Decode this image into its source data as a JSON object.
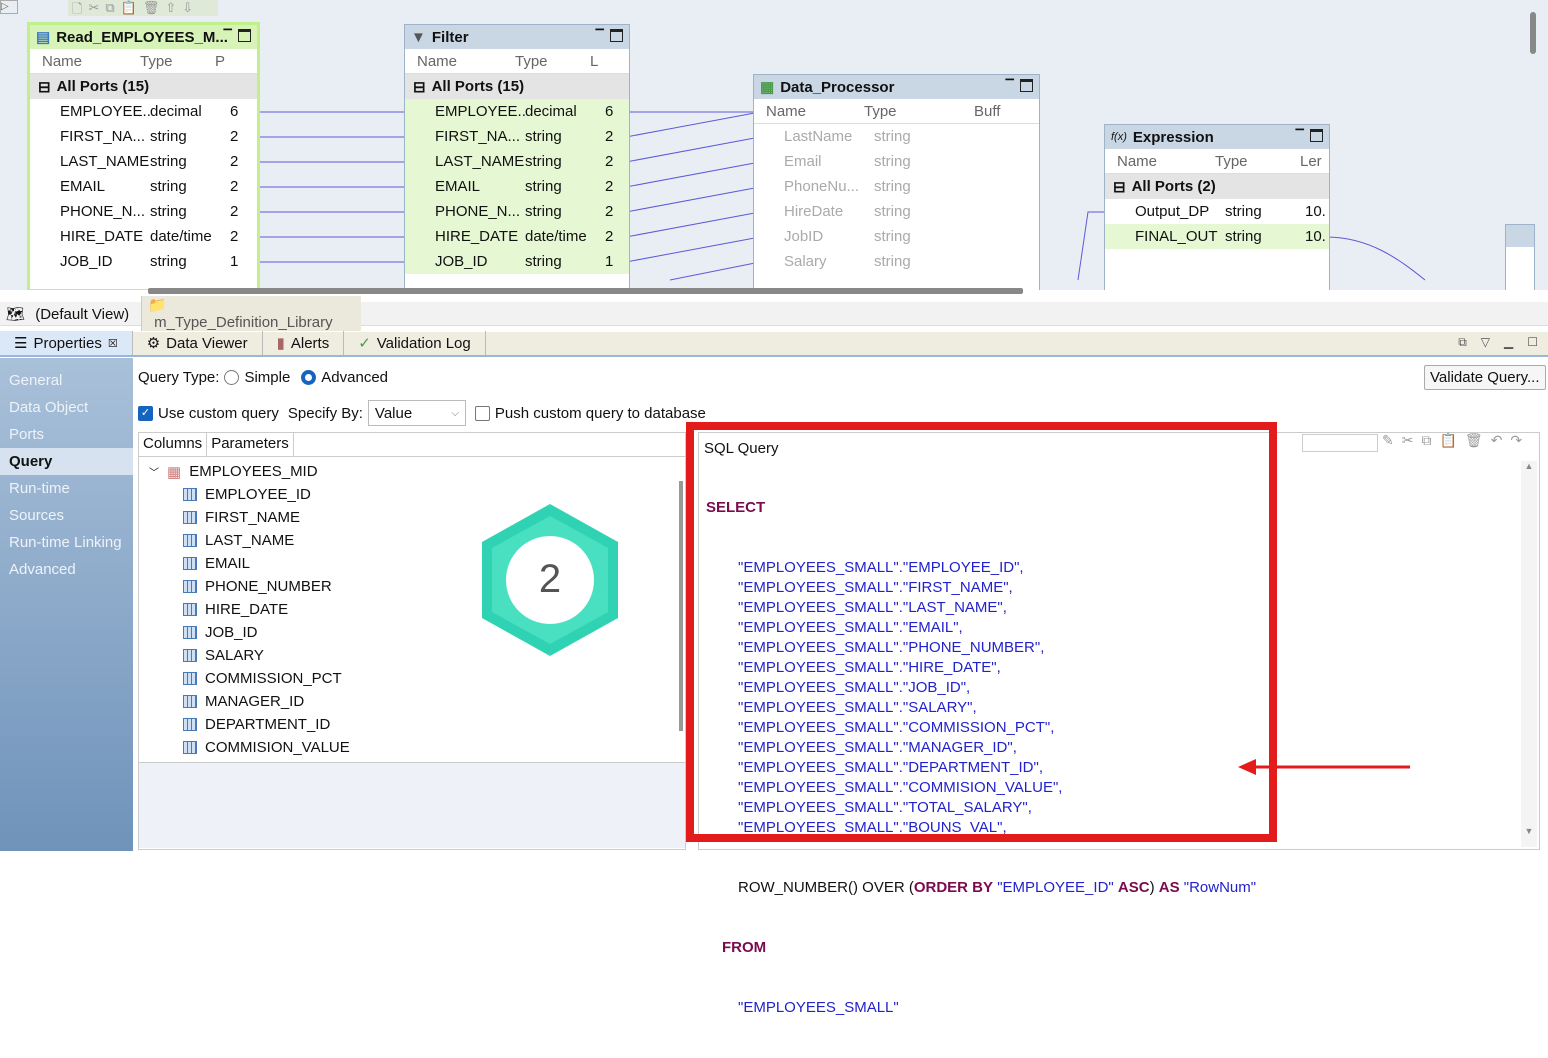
{
  "canvas": {
    "toolbar_icons": [
      "new-icon",
      "cut-icon",
      "copy-icon",
      "paste-icon",
      "delete-icon",
      "move-up-icon",
      "move-down-icon"
    ],
    "read_obj": {
      "title": "Read_EMPLOYEES_M...",
      "col_name": "Name",
      "col_type": "Type",
      "col_extra": "P",
      "group": "All Ports (15)",
      "ports": [
        {
          "n": "EMPLOYEE...",
          "t": "decimal",
          "x": "6"
        },
        {
          "n": "FIRST_NA...",
          "t": "string",
          "x": "2"
        },
        {
          "n": "LAST_NAME",
          "t": "string",
          "x": "2"
        },
        {
          "n": "EMAIL",
          "t": "string",
          "x": "2"
        },
        {
          "n": "PHONE_N...",
          "t": "string",
          "x": "2"
        },
        {
          "n": "HIRE_DATE",
          "t": "date/time",
          "x": "2"
        },
        {
          "n": "JOB_ID",
          "t": "string",
          "x": "1"
        }
      ]
    },
    "filter_obj": {
      "title": "Filter",
      "col_name": "Name",
      "col_type": "Type",
      "col_extra": "L",
      "group": "All Ports (15)",
      "ports": [
        {
          "n": "EMPLOYEE...",
          "t": "decimal",
          "x": "6"
        },
        {
          "n": "FIRST_NA...",
          "t": "string",
          "x": "2"
        },
        {
          "n": "LAST_NAME",
          "t": "string",
          "x": "2"
        },
        {
          "n": "EMAIL",
          "t": "string",
          "x": "2"
        },
        {
          "n": "PHONE_N...",
          "t": "string",
          "x": "2"
        },
        {
          "n": "HIRE_DATE",
          "t": "date/time",
          "x": "2"
        },
        {
          "n": "JOB_ID",
          "t": "string",
          "x": "1"
        }
      ]
    },
    "dp_obj": {
      "title": "Data_Processor",
      "col_name": "Name",
      "col_type": "Type",
      "col_extra": "Buff",
      "ports": [
        {
          "n": "LastName",
          "t": "string"
        },
        {
          "n": "Email",
          "t": "string"
        },
        {
          "n": "PhoneNu...",
          "t": "string"
        },
        {
          "n": "HireDate",
          "t": "string"
        },
        {
          "n": "JobID",
          "t": "string"
        },
        {
          "n": "Salary",
          "t": "string"
        }
      ]
    },
    "expr_obj": {
      "title": "Expression",
      "col_name": "Name",
      "col_type": "Type",
      "col_extra": "Ler",
      "group": "All Ports (2)",
      "ports": [
        {
          "n": "Output_DP",
          "t": "string",
          "x": "10."
        },
        {
          "n": "FINAL_OUT",
          "t": "string",
          "x": "10."
        }
      ]
    }
  },
  "editor_tabs": [
    "(Default View)",
    "m_Type_Definition_Library"
  ],
  "panel_tabs": [
    "Properties",
    "Data Viewer",
    "Alerts",
    "Validation Log"
  ],
  "sidebar": [
    "General",
    "Data Object",
    "Ports",
    "Query",
    "Run-time",
    "Sources",
    "Run-time Linking",
    "Advanced"
  ],
  "query": {
    "type_label": "Query Type:",
    "simple": "Simple",
    "advanced": "Advanced",
    "use_custom": "Use custom query",
    "specify_by": "Specify By:",
    "specify_value": "Value",
    "push": "Push custom query to database",
    "validate": "Validate Query...",
    "tab_columns": "Columns",
    "tab_parameters": "Parameters",
    "tree_root": "EMPLOYEES_MID",
    "tree_items": [
      "EMPLOYEE_ID",
      "FIRST_NAME",
      "LAST_NAME",
      "EMAIL",
      "PHONE_NUMBER",
      "HIRE_DATE",
      "JOB_ID",
      "SALARY",
      "COMMISSION_PCT",
      "MANAGER_ID",
      "DEPARTMENT_ID",
      "COMMISION_VALUE"
    ],
    "sql_label": "SQL Query",
    "select": "SELECT",
    "select_cols": [
      "\"EMPLOYEES_SMALL\".\"EMPLOYEE_ID\",",
      "\"EMPLOYEES_SMALL\".\"FIRST_NAME\",",
      "\"EMPLOYEES_SMALL\".\"LAST_NAME\",",
      "\"EMPLOYEES_SMALL\".\"EMAIL\",",
      "\"EMPLOYEES_SMALL\".\"PHONE_NUMBER\",",
      "\"EMPLOYEES_SMALL\".\"HIRE_DATE\",",
      "\"EMPLOYEES_SMALL\".\"JOB_ID\",",
      "\"EMPLOYEES_SMALL\".\"SALARY\",",
      "\"EMPLOYEES_SMALL\".\"COMMISSION_PCT\",",
      "\"EMPLOYEES_SMALL\".\"MANAGER_ID\",",
      "\"EMPLOYEES_SMALL\".\"DEPARTMENT_ID\",",
      "\"EMPLOYEES_SMALL\".\"COMMISION_VALUE\",",
      "\"EMPLOYEES_SMALL\".\"TOTAL_SALARY\",",
      "\"EMPLOYEES_SMALL\".\"BOUNS_VAL\","
    ],
    "rownum": {
      "fn": "ROW_NUMBER() OVER (",
      "order_by": "ORDER BY",
      "col": "\"EMPLOYEE_ID\"",
      "asc": "ASC",
      ")": ")",
      "as": "AS",
      "alias": "\"RowNum\""
    },
    "from": "FROM",
    "from_table": "\"EMPLOYEES_SMALL\""
  },
  "badge": {
    "number": "2",
    "color": "#2fd3b3"
  },
  "highlight_color": "#e31b1b"
}
